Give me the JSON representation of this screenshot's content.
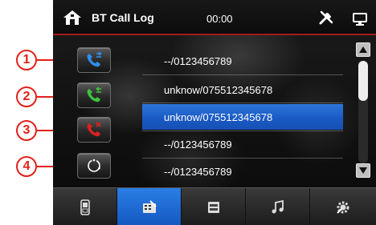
{
  "callouts": [
    "1",
    "2",
    "3",
    "4"
  ],
  "header": {
    "title": "BT Call Log",
    "time": "00:00"
  },
  "side_buttons": [
    {
      "name": "outgoing-calls",
      "icon": "phone-outgoing-icon",
      "color": "#2f8ff0"
    },
    {
      "name": "received-calls",
      "icon": "phone-incoming-icon",
      "color": "#3cc43c"
    },
    {
      "name": "missed-calls",
      "icon": "phone-missed-icon",
      "color": "#e02020"
    },
    {
      "name": "refresh",
      "icon": "refresh-icon",
      "color": "#ffffff"
    }
  ],
  "call_log": [
    {
      "text": "--/0123456789",
      "selected": false
    },
    {
      "text": "unknow/075512345678",
      "selected": false
    },
    {
      "text": "unknow/075512345678",
      "selected": true
    },
    {
      "text": "--/0123456789",
      "selected": false
    },
    {
      "text": "--/0123456789",
      "selected": false
    }
  ],
  "tabs": [
    {
      "name": "tab-phone",
      "icon": "mobile-phone-icon",
      "active": false
    },
    {
      "name": "tab-call-log",
      "icon": "keypad-tools-icon",
      "active": true
    },
    {
      "name": "tab-contacts",
      "icon": "phonebook-icon",
      "active": false
    },
    {
      "name": "tab-music",
      "icon": "music-note-icon",
      "active": false
    },
    {
      "name": "tab-settings",
      "icon": "settings-gear-icon",
      "active": false
    }
  ],
  "colors": {
    "accent": "#1a5ac4",
    "header_line": "#a31a1a",
    "callout": "#e3201b"
  }
}
